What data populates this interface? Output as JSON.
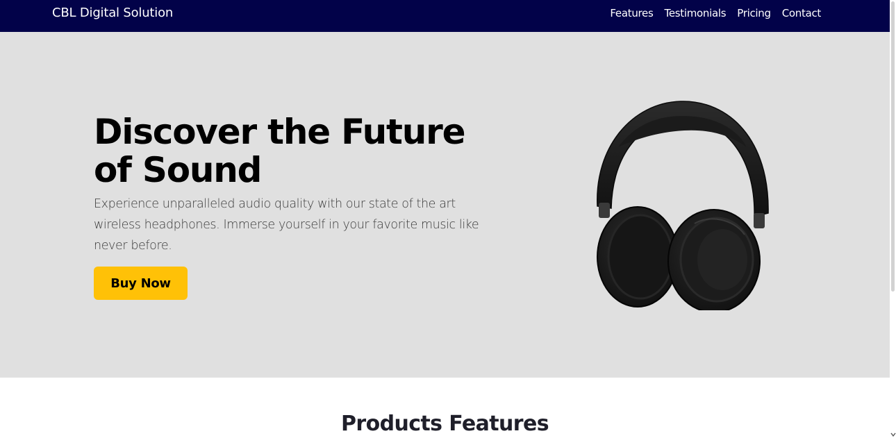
{
  "navbar": {
    "brand": "CBL Digital Solution",
    "links": [
      "Features",
      "Testimonials",
      "Pricing",
      "Contact"
    ],
    "background": "#020249"
  },
  "hero": {
    "title": "Discover the Future of Sound",
    "description": "Experience unparalleled audio quality with our state of the art wireless headphones. Immerse yourself in your favorite music like never before.",
    "button_label": "Buy Now",
    "image_icon": "headphones-image",
    "background": "#e0e0e0",
    "button_color": "#ffc107"
  },
  "features": {
    "title": "Products Features"
  },
  "scrollbar": {
    "arrow_icon": "chevron-down-icon"
  }
}
